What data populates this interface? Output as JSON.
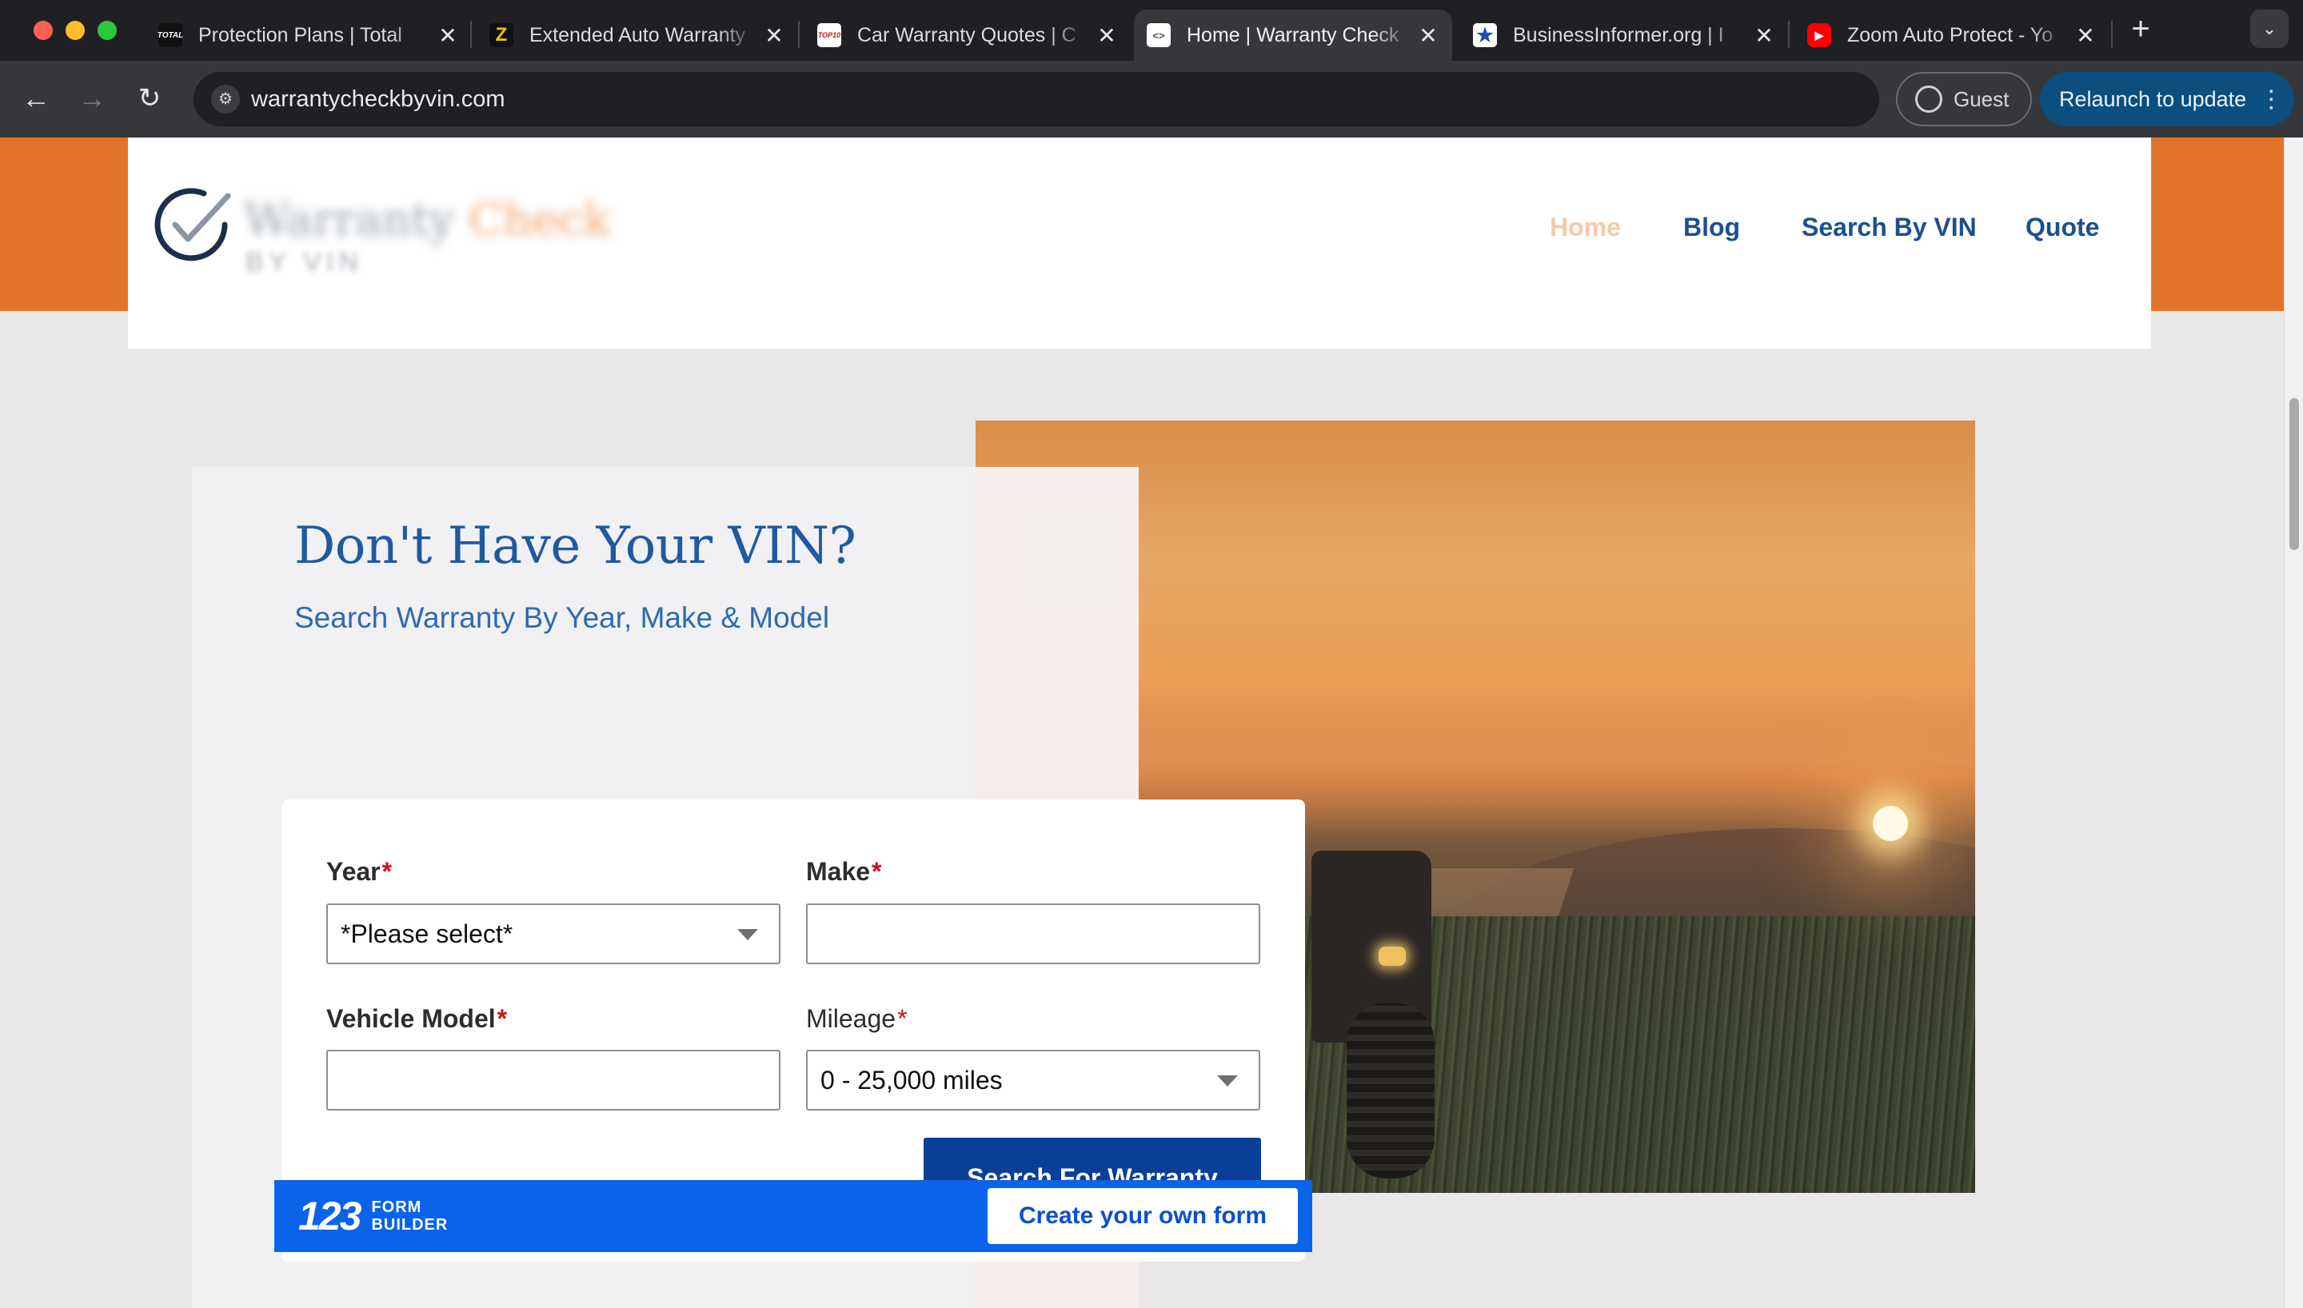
{
  "browser": {
    "tabs": [
      {
        "title": "Protection Plans | Total",
        "favicon": "total-favicon",
        "favicon_text": "TOTAL",
        "favicon_color": "#111111",
        "active": false
      },
      {
        "title": "Extended Auto Warranty",
        "favicon": "z-favicon",
        "favicon_text": "Z",
        "favicon_color": "#f2c300",
        "active": false
      },
      {
        "title": "Car Warranty Quotes | C",
        "favicon": "top10-favicon",
        "favicon_text": "TOP10",
        "favicon_color": "#c81414",
        "active": false
      },
      {
        "title": "Home | Warranty Check",
        "favicon": "code-favicon",
        "favicon_text": "<>",
        "favicon_color": "#ffffff",
        "active": true
      },
      {
        "title": "BusinessInformer.org | I",
        "favicon": "star-favicon",
        "favicon_text": "★",
        "favicon_color": "#1a4fb3",
        "active": false
      },
      {
        "title": "Zoom Auto Protect - Yo",
        "favicon": "youtube-favicon",
        "favicon_text": "▶",
        "favicon_color": "#ff0000",
        "active": false
      }
    ],
    "url": "warrantycheckbyvin.com",
    "profile_label": "Guest",
    "relaunch_label": "Relaunch to update"
  },
  "site": {
    "logo": {
      "word1": "Warranty",
      "word2": "Check",
      "sub": "BY VIN"
    },
    "nav": [
      "Home",
      "Blog",
      "Search By VIN",
      "Quote"
    ],
    "current_nav": "Home"
  },
  "hero": {
    "heading": "Don't Have Your VIN?",
    "subheading": "Search Warranty By Year, Make & Model"
  },
  "form": {
    "year": {
      "label": "Year",
      "value": "*Please select*"
    },
    "make": {
      "label": "Make",
      "value": ""
    },
    "model": {
      "label": "Vehicle Model",
      "value": ""
    },
    "mileage": {
      "label": "Mileage",
      "value": "0 - 25,000 miles"
    },
    "required_mark": "*",
    "submit_label": "Search For Warranty"
  },
  "builder": {
    "logo_number": "123",
    "logo_line1": "FORM",
    "logo_line2": "BUILDER",
    "cta": "Create your own form"
  },
  "colors": {
    "orange_band": "#e2742a",
    "nav_blue": "#1d4f8f",
    "nav_current": "#f6c9ab",
    "heading_blue": "#1f5aa0",
    "submit_blue": "#0b3f97",
    "builder_blue": "#0a63e8",
    "relaunch_bg": "#0c4e7d"
  }
}
